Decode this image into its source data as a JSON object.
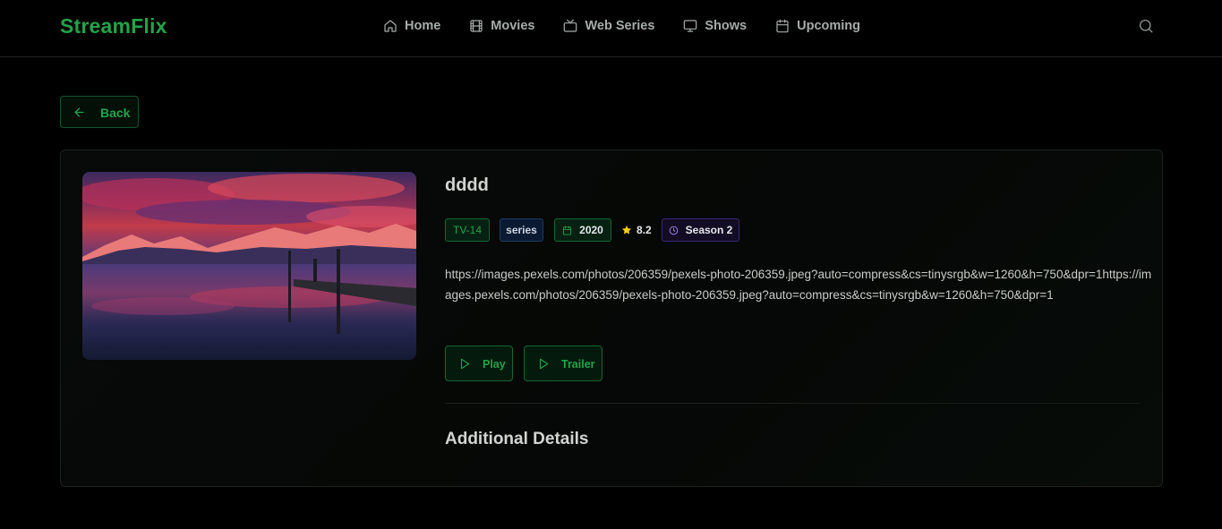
{
  "app": {
    "logo": "StreamFlix"
  },
  "nav": {
    "items": [
      {
        "label": "Home",
        "icon": "home-icon"
      },
      {
        "label": "Movies",
        "icon": "film-icon"
      },
      {
        "label": "Web Series",
        "icon": "tv-icon"
      },
      {
        "label": "Shows",
        "icon": "monitor-icon"
      },
      {
        "label": "Upcoming",
        "icon": "calendar-icon"
      }
    ],
    "search_icon": "search-icon"
  },
  "back_button": {
    "label": "Back",
    "icon": "arrow-left-icon"
  },
  "detail": {
    "title": "dddd",
    "poster_icon": "poster-image",
    "badges": {
      "rating": "TV-14",
      "type": "series",
      "year": "2020",
      "score": "8.2",
      "season": "Season 2"
    },
    "description": "https://images.pexels.com/photos/206359/pexels-photo-206359.jpeg?auto=compress&cs=tinysrgb&w=1260&h=750&dpr=1https://images.pexels.com/photos/206359/pexels-photo-206359.jpeg?auto=compress&cs=tinysrgb&w=1260&h=750&dpr=1",
    "play_label": "Play",
    "trailer_label": "Trailer",
    "additional_title": "Additional Details"
  },
  "colors": {
    "accent": "#22a34a",
    "background": "#000000",
    "star": "#facc15",
    "season_accent": "#a78bfa"
  }
}
